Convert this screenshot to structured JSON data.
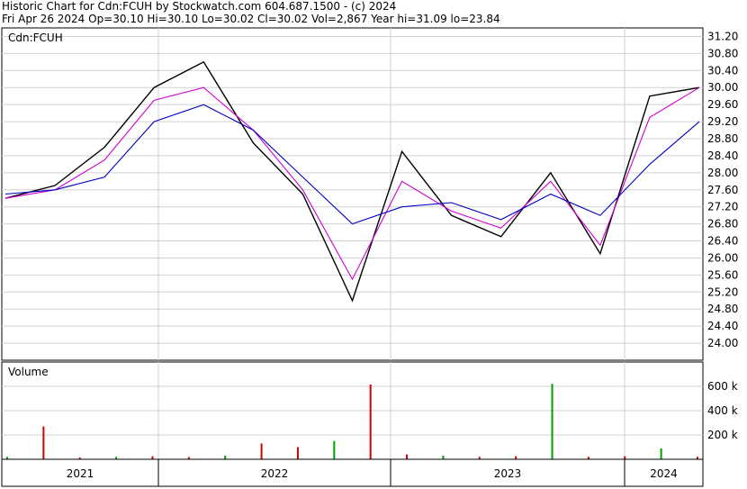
{
  "header": {
    "line1": "Historic Chart for Cdn:FCUH by Stockwatch.com 604.687.1500 - (c) 2024",
    "line2": "Fri Apr 26 2024   Op=30.10   Hi=30.10   Lo=30.02   Cl=30.02   Vol=2,867   Year hi=31.09   lo=23.84"
  },
  "chart_data": [
    {
      "type": "line",
      "title": "Cdn:FCUH",
      "ylim": [
        23.6,
        31.4
      ],
      "y_ticks": [
        "24.00",
        "24.40",
        "24.80",
        "25.20",
        "25.60",
        "26.00",
        "26.40",
        "26.80",
        "27.20",
        "27.60",
        "28.00",
        "28.40",
        "28.80",
        "29.20",
        "29.60",
        "30.00",
        "30.40",
        "30.80",
        "31.20"
      ],
      "grid": true,
      "x": [
        "2021-03",
        "2021-06",
        "2021-09",
        "2021-12",
        "2022-03",
        "2022-06",
        "2022-09",
        "2022-12",
        "2023-03",
        "2023-06",
        "2023-09",
        "2023-12",
        "2024-03",
        "2024-04"
      ],
      "series": [
        {
          "name": "",
          "color": "#000000",
          "values": [
            27.4,
            27.7,
            28.6,
            30.0,
            30.6,
            28.7,
            27.5,
            25.0,
            28.5,
            27.0,
            26.5,
            28.0,
            26.1,
            29.8,
            30.0
          ]
        },
        {
          "name": "",
          "color": "#d000d0",
          "values": [
            27.4,
            27.6,
            28.3,
            29.7,
            30.0,
            29.0,
            27.6,
            25.5,
            27.8,
            27.1,
            26.7,
            27.8,
            26.3,
            29.3,
            30.0
          ]
        },
        {
          "name": "",
          "color": "#0000c0",
          "values": [
            27.5,
            27.6,
            27.9,
            29.2,
            29.6,
            29.0,
            27.9,
            26.8,
            27.2,
            27.3,
            26.9,
            27.5,
            27.0,
            28.2,
            29.2
          ]
        }
      ]
    },
    {
      "type": "bar",
      "title": "Volume",
      "ylim": [
        0,
        800
      ],
      "y_ticks": [
        "200 k",
        "400 k",
        "600 k"
      ],
      "grid": true,
      "values": [
        20,
        270,
        15,
        20,
        25,
        18,
        30,
        130,
        100,
        150,
        615,
        40,
        30,
        20,
        25,
        620,
        20,
        25,
        90,
        20
      ]
    }
  ],
  "x_axis": {
    "years": [
      "2021",
      "2022",
      "2023",
      "2024"
    ]
  }
}
